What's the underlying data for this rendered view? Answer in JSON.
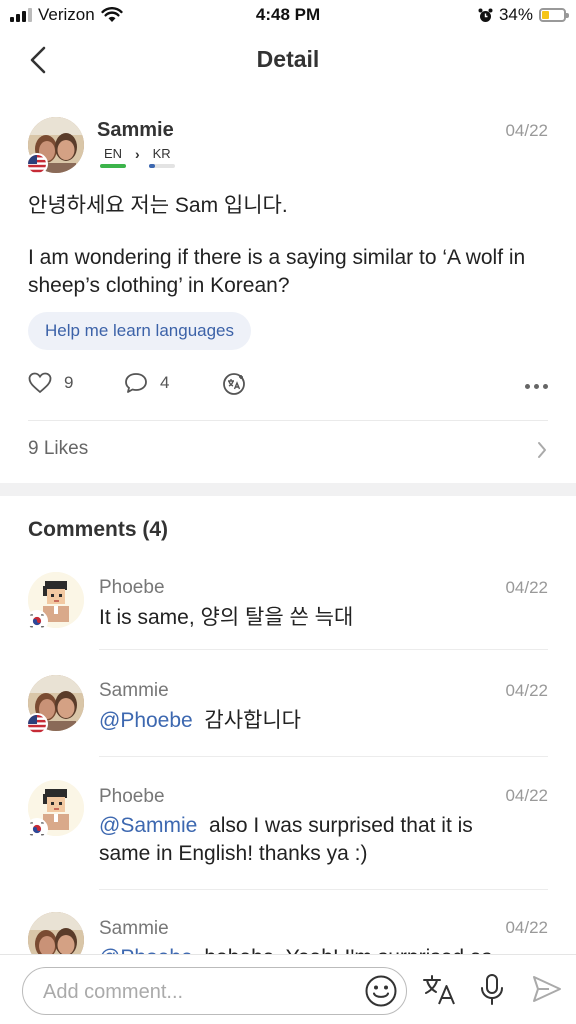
{
  "status_bar": {
    "carrier": "Verizon",
    "time": "4:48 PM",
    "battery": "34%",
    "battery_level": 0.34,
    "battery_color": "#f5c518"
  },
  "nav": {
    "title": "Detail",
    "back_icon": "chevron-left-icon"
  },
  "post": {
    "author": "Sammie",
    "date": "04/22",
    "native_lang": "EN",
    "learning_lang": "KR",
    "native_bar_color": "#3cb44b",
    "learning_bar_color": "#3d68b0",
    "text_line1": "안녕하세요 저는 Sam 입니다.",
    "text_line2": "I am wondering if there is a saying similar to ‘A wolf in sheep’s clothing’ in Korean?",
    "tag": "Help me learn languages",
    "like_count": "9",
    "comment_count": "4",
    "likes_label": "9 Likes"
  },
  "comments": {
    "title": "Comments (4)",
    "items": [
      {
        "author": "Phoebe",
        "date": "04/22",
        "mention": "",
        "text": "It is same, 양의 탈을 쓴 늑대",
        "flag": "kr-flag-icon"
      },
      {
        "author": "Sammie",
        "date": "04/22",
        "mention": "@Phoebe",
        "text": "감사합니다",
        "flag": "us-flag-icon"
      },
      {
        "author": "Phoebe",
        "date": "04/22",
        "mention": "@Sammie",
        "text": "also I was surprised that it is same in English! thanks ya :)",
        "flag": "kr-flag-icon"
      },
      {
        "author": "Sammie",
        "date": "04/22",
        "mention": "@Phoebe",
        "text": "hahaha. Yeah! I'm surprised as",
        "flag": "us-flag-icon"
      }
    ]
  },
  "composer": {
    "placeholder": "Add comment...",
    "icons": [
      "emoji-icon",
      "translate-icon",
      "microphone-icon",
      "send-icon"
    ]
  },
  "colors": {
    "mention": "#3d68b0",
    "tag_bg": "#eef1f8",
    "tag_text": "#3c62a8"
  }
}
